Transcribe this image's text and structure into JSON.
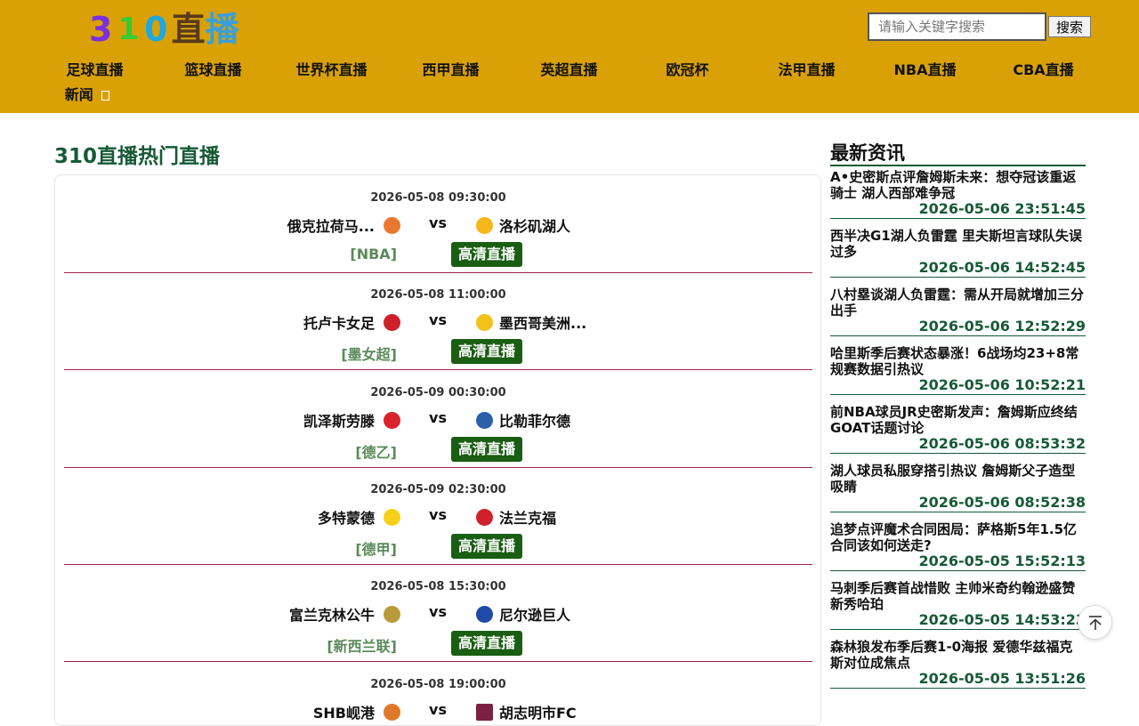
{
  "logo": {
    "p1": "3",
    "p2": "1",
    "p3": "0",
    "p4": "直",
    "p5": "播"
  },
  "search": {
    "placeholder": "请输入关键字搜索",
    "button": "搜索"
  },
  "nav": [
    "足球直播",
    "篮球直播",
    "世界杯直播",
    "西甲直播",
    "英超直播",
    "欧冠杯",
    "法甲直播",
    "NBA直播",
    "CBA直播",
    "新闻"
  ],
  "main": {
    "title": "310直播热门直播",
    "watch_label": "高清直播",
    "vs_label": "vs",
    "matches": [
      {
        "time": "2026-05-08 09:30:00",
        "home": "俄克拉荷马...",
        "away": "洛杉矶湖人",
        "league": "[NBA]",
        "home_color": "#e8782f",
        "away_color": "#f5b81c"
      },
      {
        "time": "2026-05-08 11:00:00",
        "home": "托卢卡女足",
        "away": "墨西哥美洲...",
        "league": "[墨女超]",
        "home_color": "#d0202c",
        "away_color": "#f2c21a"
      },
      {
        "time": "2026-05-09 00:30:00",
        "home": "凯泽斯劳滕",
        "away": "比勒菲尔德",
        "league": "[德乙]",
        "home_color": "#d9222a",
        "away_color": "#2b5fa8"
      },
      {
        "time": "2026-05-09 02:30:00",
        "home": "多特蒙德",
        "away": "法兰克福",
        "league": "[德甲]",
        "home_color": "#f7d117",
        "away_color": "#d0202c"
      },
      {
        "time": "2026-05-08 15:30:00",
        "home": "富兰克林公牛",
        "away": "尼尔逊巨人",
        "league": "[新西兰联]",
        "home_color": "#b89a3a",
        "away_color": "#1e4aa8"
      },
      {
        "time": "2026-05-08 19:00:00",
        "home": "SHB岘港",
        "away": "胡志明市FC",
        "league": "",
        "home_color": "#e0782a",
        "away_color": "#7a2040"
      }
    ]
  },
  "sidebar": {
    "title": "最新资讯",
    "news": [
      {
        "title": "A•史密斯点评詹姆斯未来：想夺冠该重返骑士 湖人西部难争冠",
        "time": "2026-05-06 23:51:45"
      },
      {
        "title": "西半决G1湖人负雷霆 里夫斯坦言球队失误过多",
        "time": "2026-05-06 14:52:45"
      },
      {
        "title": "八村塁谈湖人负雷霆：需从开局就增加三分出手",
        "time": "2026-05-06 12:52:29"
      },
      {
        "title": "哈里斯季后赛状态暴涨！6战场均23+8常规赛数据引热议",
        "time": "2026-05-06 10:52:21"
      },
      {
        "title": "前NBA球员JR史密斯发声：詹姆斯应终结GOAT话题讨论",
        "time": "2026-05-06 08:53:32"
      },
      {
        "title": "湖人球员私服穿搭引热议 詹姆斯父子造型吸睛",
        "time": "2026-05-06 08:52:38"
      },
      {
        "title": "追梦点评魔术合同困局：萨格斯5年1.5亿合同该如何送走?",
        "time": "2026-05-05 15:52:13"
      },
      {
        "title": "马刺季后赛首战惜败 主帅米奇约翰逊盛赞新秀哈珀",
        "time": "2026-05-05 14:53:23"
      },
      {
        "title": "森林狼发布季后赛1-0海报 爱德华兹福克斯对位成焦点",
        "time": "2026-05-05 13:51:26"
      }
    ]
  },
  "colors": {
    "header_bg": "#d9a106",
    "accent_green": "#165a37",
    "button_green": "#1a5e13",
    "divider": "#a0224a"
  }
}
